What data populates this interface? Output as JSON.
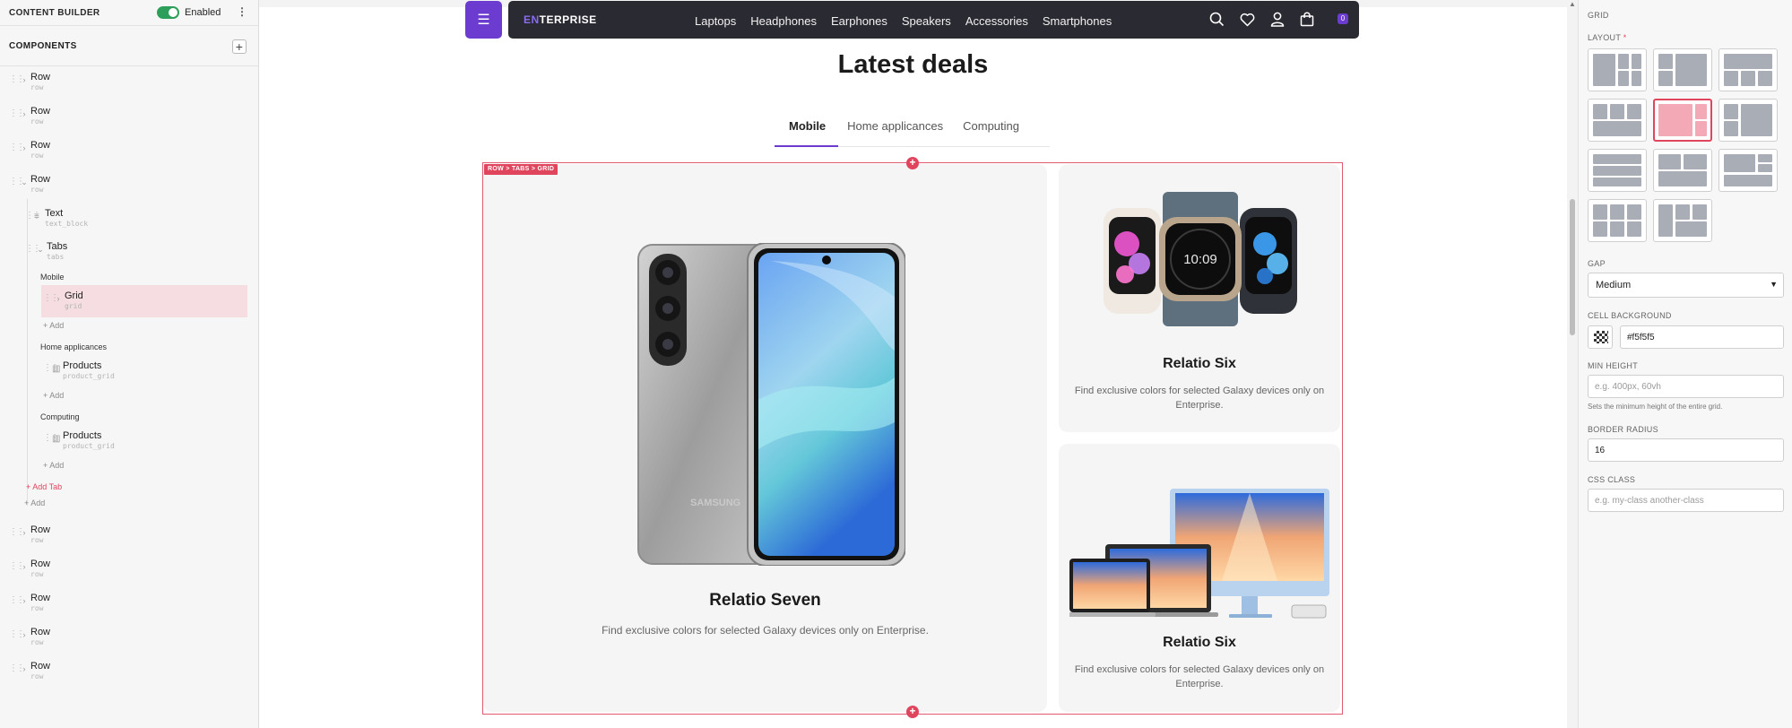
{
  "builder": {
    "title": "CONTENT BUILDER",
    "toggle_label": "Enabled",
    "components_title": "COMPONENTS"
  },
  "tree": {
    "rows_top": [
      {
        "name": "Row",
        "type": "row"
      },
      {
        "name": "Row",
        "type": "row"
      },
      {
        "name": "Row",
        "type": "row"
      },
      {
        "name": "Row",
        "type": "row"
      }
    ],
    "text_node": {
      "name": "Text",
      "type": "text_block"
    },
    "tabs_node": {
      "name": "Tabs",
      "type": "tabs"
    },
    "tab_mobile": "Mobile",
    "grid_node": {
      "name": "Grid",
      "type": "grid"
    },
    "tab_home": "Home applicances",
    "products_1": {
      "name": "Products",
      "type": "product_grid"
    },
    "tab_computing": "Computing",
    "products_2": {
      "name": "Products",
      "type": "product_grid"
    },
    "add_label": "+ Add",
    "add_tab_label": "+ Add Tab",
    "rows_bottom": [
      {
        "name": "Row",
        "type": "row"
      },
      {
        "name": "Row",
        "type": "row"
      },
      {
        "name": "Row",
        "type": "row"
      },
      {
        "name": "Row",
        "type": "row"
      },
      {
        "name": "Row",
        "type": "row"
      }
    ]
  },
  "site": {
    "logo_prefix": "EN",
    "logo_rest": "TERPRISE",
    "nav": [
      "Laptops",
      "Headphones",
      "Earphones",
      "Speakers",
      "Accessories",
      "Smartphones"
    ],
    "cart_count": "0",
    "heading": "Latest deals",
    "tabs": [
      "Mobile",
      "Home applicances",
      "Computing"
    ],
    "active_tab": "Mobile",
    "grid_badge": "ROW > TABS > GRID",
    "cards": {
      "big": {
        "title": "Relatio Seven",
        "desc": "Find exclusive colors for selected Galaxy devices only on Enterprise.",
        "phone_brand": "SAMSUNG",
        "image": "phone-image"
      },
      "top": {
        "title": "Relatio Six",
        "desc": "Find exclusive colors for selected Galaxy devices only on Enterprise.",
        "watch_time": "10:09",
        "image": "watches-image"
      },
      "bottom": {
        "title": "Relatio Six",
        "desc": "Find exclusive colors for selected Galaxy devices only on Enterprise.",
        "image": "mac-devices-image"
      }
    }
  },
  "panel": {
    "section": "GRID",
    "layout_label": "LAYOUT",
    "required_mark": "*",
    "selected_layout_index": 4,
    "gap_label": "GAP",
    "gap_value": "Medium",
    "cell_bg_label": "CELL BACKGROUND",
    "cell_bg_value": "#f5f5f5",
    "min_height_label": "MIN HEIGHT",
    "min_height_placeholder": "e.g. 400px, 60vh",
    "min_height_hint": "Sets the minimum height of the entire grid.",
    "radius_label": "BORDER RADIUS",
    "radius_value": "16",
    "css_label": "CSS CLASS",
    "css_placeholder": "e.g. my-class another-class"
  },
  "colors": {
    "accent": "#6b3ccf",
    "selection": "#e0455e",
    "navbar": "#2a2a32",
    "cell_bg": "#f5f5f5"
  }
}
